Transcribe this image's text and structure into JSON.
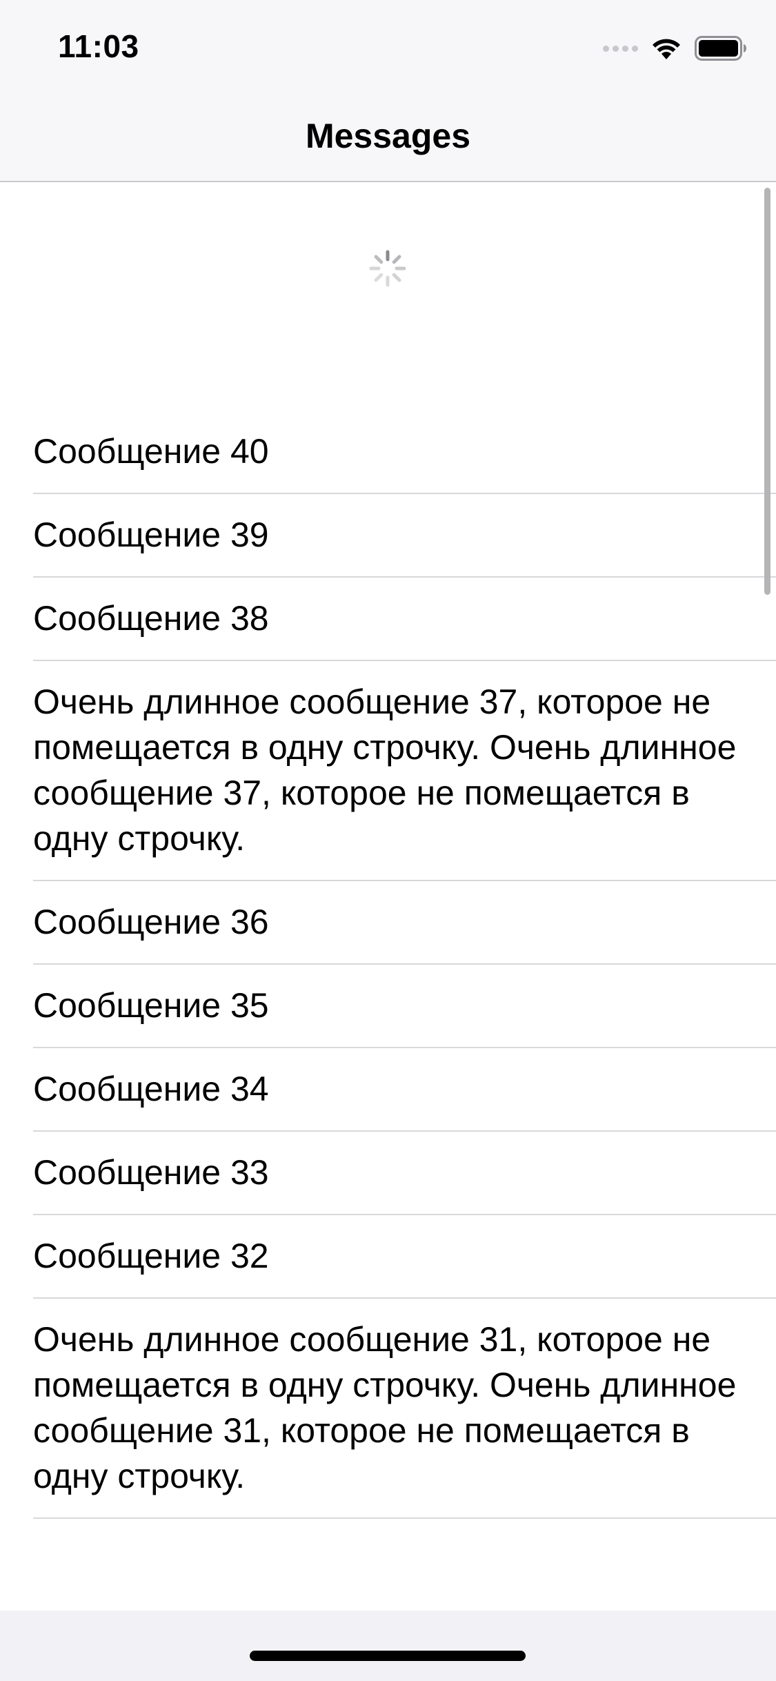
{
  "status_bar": {
    "time": "11:03",
    "icons": [
      "cellular-icon",
      "wifi-icon",
      "battery-icon"
    ]
  },
  "nav": {
    "title": "Messages"
  },
  "loading": {
    "icon": "activity-spinner-icon"
  },
  "messages": [
    {
      "text": "Сообщение 40"
    },
    {
      "text": "Сообщение 39"
    },
    {
      "text": "Сообщение 38"
    },
    {
      "text": "Очень длинное сообщение 37, которое не помещается в одну строчку. Очень длинное сообщение 37, которое не помещается в одну строчку."
    },
    {
      "text": "Сообщение 36"
    },
    {
      "text": "Сообщение 35"
    },
    {
      "text": "Сообщение 34"
    },
    {
      "text": "Сообщение 33"
    },
    {
      "text": "Сообщение 32"
    },
    {
      "text": "Очень длинное сообщение 31, которое не помещается в одну строчку. Очень длинное сообщение 31, которое не помещается в одну строчку."
    }
  ],
  "colors": {
    "bar_background": "#f7f7f9",
    "separator": "#d8d8dc",
    "text": "#000000"
  }
}
